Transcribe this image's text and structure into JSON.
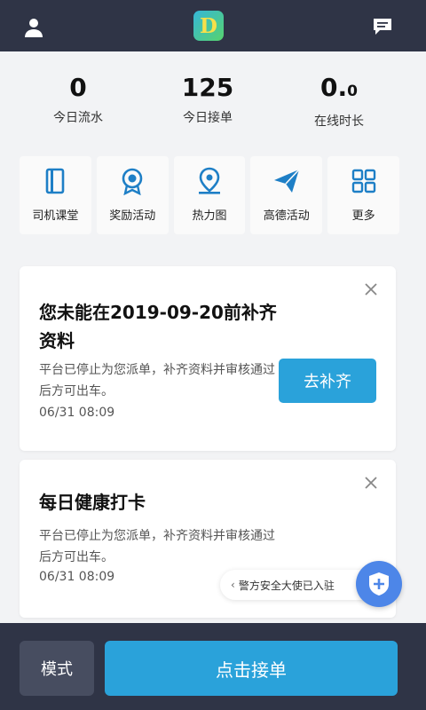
{
  "header": {
    "logo_letter": "D",
    "user_icon": "user-icon",
    "message_icon": "message-icon"
  },
  "stats": [
    {
      "value": "0",
      "label": "今日流水"
    },
    {
      "value": "125",
      "label": "今日接单"
    },
    {
      "value_main": "0.",
      "value_small": "0",
      "label": "在线时长"
    }
  ],
  "shortcuts": [
    {
      "icon": "book-icon",
      "label": "司机课堂"
    },
    {
      "icon": "award-icon",
      "label": "奖励活动"
    },
    {
      "icon": "location-pin-icon",
      "label": "热力图"
    },
    {
      "icon": "paper-plane-icon",
      "label": "高德活动"
    },
    {
      "icon": "grid-icon",
      "label": "更多"
    }
  ],
  "cards": [
    {
      "title": "您未能在2019-09-20前补齐资料",
      "desc": "平台已停止为您派单，补齐资料并审核通过后方可出车。",
      "time": "06/31 08:09",
      "action": "去补齐"
    },
    {
      "title": "每日健康打卡",
      "desc": "平台已停止为您派单，补齐资料并审核通过后方可出车。",
      "time": "06/31 08:09"
    }
  ],
  "police_tip": "警方安全大使已入驻",
  "footer": {
    "mode_label": "模式",
    "grab_label": "点击接单"
  },
  "colors": {
    "header_bg": "#2f3446",
    "accent": "#2aa2da",
    "icon_blue": "#1e7fc6"
  }
}
